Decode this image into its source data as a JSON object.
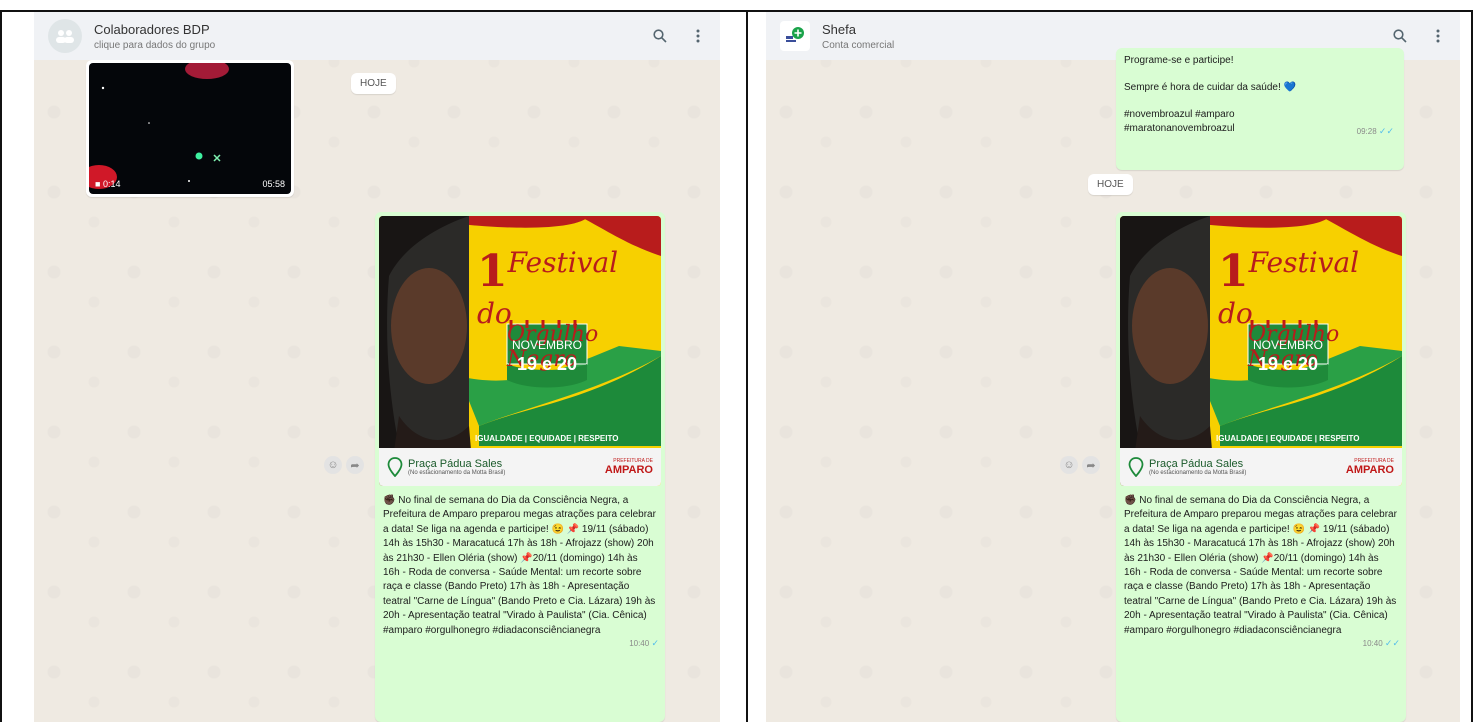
{
  "left": {
    "header": {
      "title": "Colaboradores BDP",
      "subtitle": "clique para dados do grupo"
    },
    "date_pill": "HOJE",
    "video": {
      "duration": "0:14",
      "time": "05:58"
    },
    "post": {
      "time": "10:40"
    }
  },
  "right": {
    "header": {
      "title": "Shefa",
      "subtitle": "Conta comercial"
    },
    "prev_message": {
      "line1": "Programe-se e participe!",
      "line2": "Sempre é hora de cuidar da saúde! 💙",
      "line3": "#novembroazul #amparo",
      "line4": "#maratonanovembroazul",
      "time": "09:28"
    },
    "date_pill": "HOJE",
    "post": {
      "time": "10:40"
    }
  },
  "poster": {
    "number": "1",
    "title_line1": "Festival do",
    "title_line2": "Orgulho Negro",
    "month": "NOVEMBRO",
    "days": "19 e 20",
    "values": "IGUALDADE | EQUIDADE | RESPEITO",
    "place": "Praça Pádua Sales",
    "place_sub": "(No estacionamento da Motta Brasil)",
    "brand_top": "PREFEITURA DE",
    "brand": "AMPARO"
  },
  "caption": "✊🏿 No final de semana do Dia da Consciência Negra, a Prefeitura de Amparo preparou megas atrações para celebrar a data!  Se liga na agenda e participe! 😉 📌 19/11 (sábado)  14h às 15h30 - Maracatucá  17h às 18h - Afrojazz (show)  20h às 21h30 - Ellen Oléria (show)  📌20/11 (domingo)  14h às 16h - Roda de conversa - Saúde Mental: um recorte sobre raça e classe (Bando Preto)  17h às 18h - Apresentação teatral \"Carne de Língua\" (Bando Preto e Cia. Lázara)  19h às 20h - Apresentação teatral \"Virado à Paulista\" (Cia. Cênica)  #amparo #orgulhonegro #diadaconsciêncianegra",
  "icons": {
    "search": "search-icon",
    "menu": "kebab-menu-icon",
    "group": "group-avatar-icon",
    "emoji": "emoji-icon",
    "forward": "forward-icon",
    "video": "video-camera-icon",
    "check": "double-check-icon"
  }
}
